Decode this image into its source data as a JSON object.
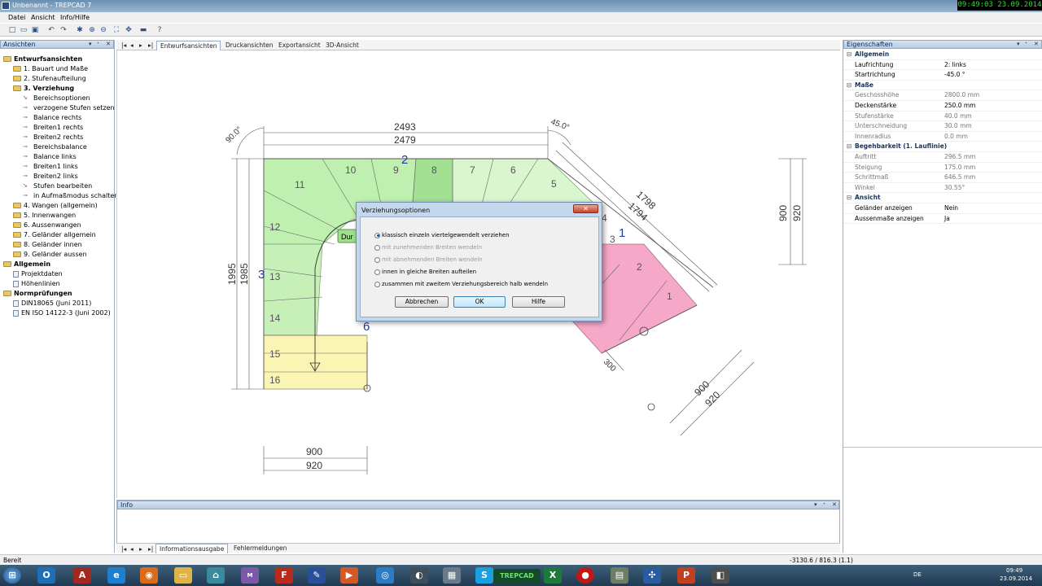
{
  "window": {
    "title": "Unbenannt - TREPCAD 7",
    "clock": "09:49:03 23.09.2014"
  },
  "menu": [
    "Datei",
    "Ansicht",
    "Info/Hilfe"
  ],
  "left_panel": {
    "title": "Ansichten",
    "tree": [
      {
        "label": "Entwurfsansichten",
        "level": 0,
        "icon": "folder-icon",
        "bold": true
      },
      {
        "label": "1. Bauart und Maße",
        "level": 1,
        "icon": "folder-icon"
      },
      {
        "label": "2. Stufenaufteilung",
        "level": 1,
        "icon": "folder-icon"
      },
      {
        "label": "3. Verziehung",
        "level": 1,
        "icon": "folder-icon",
        "bold": true
      },
      {
        "label": "Bereichsoptionen",
        "level": 2,
        "icon": "cursor-icon"
      },
      {
        "label": "verzogene Stufen setzen",
        "level": 2,
        "icon": "gear-icon"
      },
      {
        "label": "Balance rechts",
        "level": 2,
        "icon": "gear-icon"
      },
      {
        "label": "Breiten1 rechts",
        "level": 2,
        "icon": "gear-icon"
      },
      {
        "label": "Breiten2 rechts",
        "level": 2,
        "icon": "gear-icon"
      },
      {
        "label": "Bereichsbalance",
        "level": 2,
        "icon": "gear-icon"
      },
      {
        "label": "Balance links",
        "level": 2,
        "icon": "gear-icon"
      },
      {
        "label": "Breiten1 links",
        "level": 2,
        "icon": "gear-icon"
      },
      {
        "label": "Breiten2 links",
        "level": 2,
        "icon": "gear-icon"
      },
      {
        "label": "Stufen bearbeiten",
        "level": 2,
        "icon": "cursor-icon"
      },
      {
        "label": "in Aufmaßmodus schalten",
        "level": 2,
        "icon": "gear-icon"
      },
      {
        "label": "4. Wangen (allgemein)",
        "level": 1,
        "icon": "folder-icon"
      },
      {
        "label": "5. Innenwangen",
        "level": 1,
        "icon": "folder-icon"
      },
      {
        "label": "6. Aussenwangen",
        "level": 1,
        "icon": "folder-icon"
      },
      {
        "label": "7. Geländer allgemein",
        "level": 1,
        "icon": "folder-icon"
      },
      {
        "label": "8. Geländer innen",
        "level": 1,
        "icon": "folder-icon"
      },
      {
        "label": "9. Geländer aussen",
        "level": 1,
        "icon": "folder-icon"
      },
      {
        "label": "Allgemein",
        "level": 0,
        "icon": "folder-icon",
        "bold": true
      },
      {
        "label": "Projektdaten",
        "level": 1,
        "icon": "doc-icon"
      },
      {
        "label": "Höhenlinien",
        "level": 1,
        "icon": "doc-icon"
      },
      {
        "label": "Normprüfungen",
        "level": 0,
        "icon": "folder-icon",
        "bold": true
      },
      {
        "label": "DIN18065 (Juni 2011)",
        "level": 1,
        "icon": "doc-icon"
      },
      {
        "label": "EN ISO 14122-3 (Juni 2002)",
        "level": 1,
        "icon": "doc-icon"
      }
    ]
  },
  "view_tabs": [
    "Entwurfsansichten",
    "Druckansichten",
    "Exportansicht",
    "3D-Ansicht"
  ],
  "drawing": {
    "dims": {
      "top_outer": "2493",
      "top_inner": "2479",
      "left_outer": "1995",
      "left_inner": "1985",
      "bottom_a": "900",
      "bottom_b": "920",
      "right_a": "900",
      "right_b": "920",
      "diag_a": "1798",
      "diag_b": "1794",
      "diag2_a": "900",
      "diag2_b": "920",
      "small": "300",
      "angle_left": "90.0°",
      "angle_right": "45.0°"
    },
    "steps": [
      "16",
      "15",
      "14",
      "13",
      "12",
      "11",
      "10",
      "9",
      "8",
      "7",
      "6",
      "5",
      "4",
      "3",
      "2",
      "1"
    ],
    "markers": [
      "2",
      "3",
      "1",
      "6"
    ],
    "label_box": "Dur"
  },
  "dialog": {
    "title": "Verziehungsoptionen",
    "close": "✕",
    "options": [
      {
        "label": "klassisch einzeln viertelgewendelt verziehen",
        "selected": true,
        "disabled": false
      },
      {
        "label": "mit zunehmenden Breiten wendeln",
        "selected": false,
        "disabled": true
      },
      {
        "label": "mit abnehmenden Breiten wendeln",
        "selected": false,
        "disabled": true
      },
      {
        "label": "innen in gleiche Breiten aufteilen",
        "selected": false,
        "disabled": false
      },
      {
        "label": "zusammen mit zweitem Verziehungsbereich halb wendeln",
        "selected": false,
        "disabled": false
      }
    ],
    "buttons": {
      "cancel": "Abbrechen",
      "ok": "OK",
      "help": "Hilfe"
    }
  },
  "info_panel": {
    "title": "Info",
    "tabs": [
      "Informationsausgabe",
      "Fehlermeldungen"
    ]
  },
  "properties": {
    "title": "Eigenschaften",
    "rows": [
      {
        "k": "Allgemein",
        "v": "",
        "group": true
      },
      {
        "k": "Laufrichtung",
        "v": "2: links"
      },
      {
        "k": "Startrichtung",
        "v": "-45.0 °"
      },
      {
        "k": "Maße",
        "v": "",
        "group": true
      },
      {
        "k": "Geschosshöhe",
        "v": "2800.0 mm",
        "dim": true
      },
      {
        "k": "Deckenstärke",
        "v": "250.0 mm"
      },
      {
        "k": "Stufenstärke",
        "v": "40.0 mm",
        "dim": true
      },
      {
        "k": "Unterschneidung",
        "v": "30.0 mm",
        "dim": true
      },
      {
        "k": "Innenradius",
        "v": "0.0 mm",
        "dim": true
      },
      {
        "k": "Begehbarkeit (1. Lauflinie)",
        "v": "",
        "group": true
      },
      {
        "k": "Auftritt",
        "v": "296.5 mm",
        "dim": true
      },
      {
        "k": "Steigung",
        "v": "175.0 mm",
        "dim": true
      },
      {
        "k": "Schrittmaß",
        "v": "646.5 mm",
        "dim": true
      },
      {
        "k": "Winkel",
        "v": "30.55°",
        "dim": true
      },
      {
        "k": "Ansicht",
        "v": "",
        "group": true
      },
      {
        "k": "Geländer anzeigen",
        "v": "Nein"
      },
      {
        "k": "Aussenmaße anzeigen",
        "v": "Ja"
      }
    ]
  },
  "status": {
    "left": "Bereit",
    "coords": "-3130.6 / 816.3 (1.1)"
  },
  "taskbar": {
    "lang": "DE",
    "time": "09:49",
    "date": "23.09.2014",
    "trepcad_label": "TREPCAD"
  }
}
